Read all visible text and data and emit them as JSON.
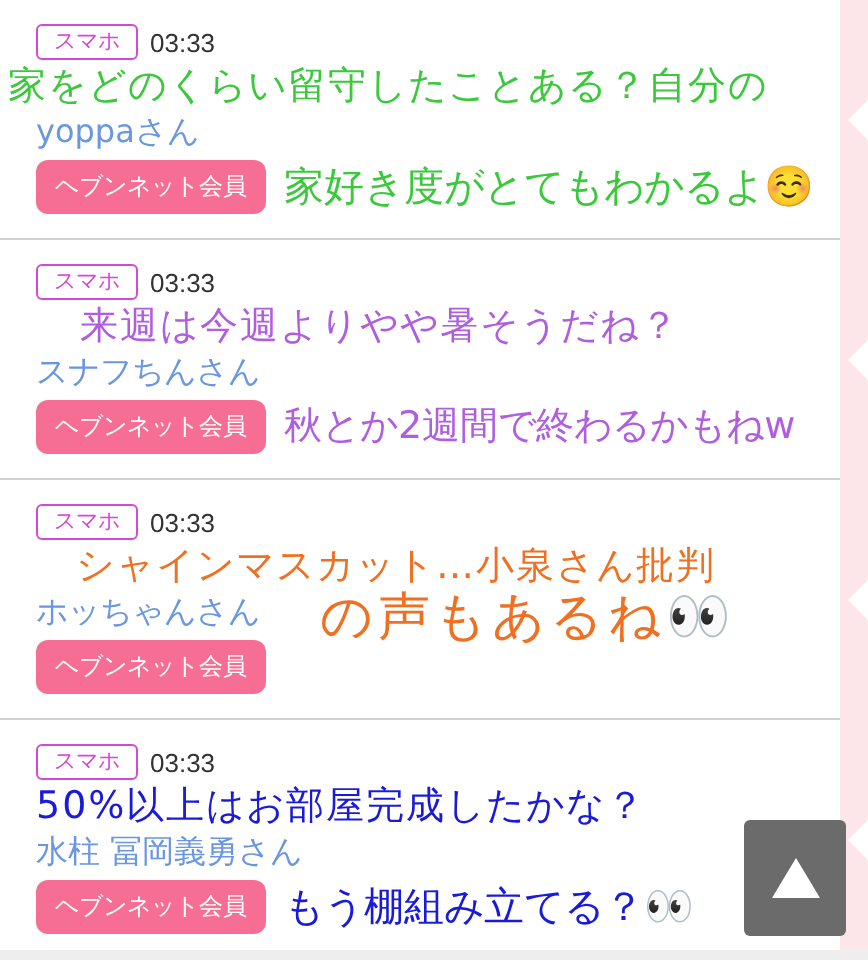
{
  "posts": [
    {
      "badge": "スマホ",
      "time": "03:33",
      "name": "yoppaさん",
      "member_button": "ヘブンネット会員",
      "caption": {
        "color": "#3cc83c",
        "lines": [
          "家をどのくらい留守したことある？自分の",
          "家好き度がとてもわかるよ☺️"
        ]
      }
    },
    {
      "badge": "スマホ",
      "time": "03:33",
      "name": "スナフちんさん",
      "member_button": "ヘブンネット会員",
      "caption": {
        "color": "#b05ee0",
        "lines": [
          "来週は今週よりやや暑そうだね？",
          "秋とか2週間で終わるかもねw"
        ]
      }
    },
    {
      "badge": "スマホ",
      "time": "03:33",
      "name": "ホッちゃんさん",
      "member_button": "ヘブンネット会員",
      "caption": {
        "color": "#f07022",
        "lines": [
          "シャインマスカット…小泉さん批判",
          "の声もあるね👀"
        ]
      }
    },
    {
      "badge": "スマホ",
      "time": "03:33",
      "name": "水柱 冨岡義勇さん",
      "member_button": "ヘブンネット会員",
      "caption": {
        "color": "#1a1ad8",
        "lines": [
          "50%以上はお部屋完成したかな？",
          "もう棚組み立てる？👀"
        ]
      }
    }
  ]
}
